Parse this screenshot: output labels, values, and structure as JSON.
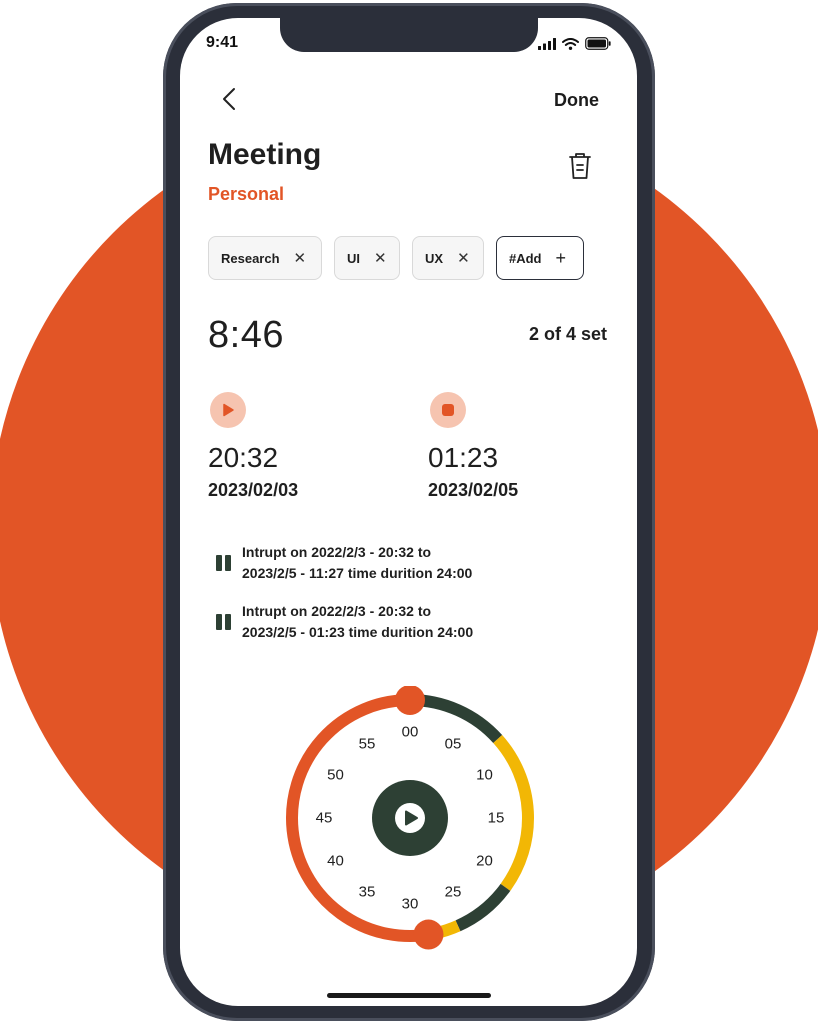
{
  "status_bar": {
    "time": "9:41"
  },
  "nav": {
    "done_label": "Done"
  },
  "task": {
    "title": "Meeting",
    "category": "Personal"
  },
  "tags": [
    {
      "label": "Research"
    },
    {
      "label": "UI"
    },
    {
      "label": "UX"
    }
  ],
  "add_tag": {
    "label": "#Add"
  },
  "timer": {
    "elapsed": "8:46",
    "set_progress": "2 of 4 set"
  },
  "sessions": {
    "start": {
      "time": "20:32",
      "date": "2023/02/03",
      "icon": "play-icon"
    },
    "end": {
      "time": "01:23",
      "date": "2023/02/05",
      "icon": "stop-icon"
    }
  },
  "interruptions": [
    {
      "line1": "Intrupt on 2022/2/3 - 20:32  to",
      "line2": "2023/2/5 - 11:27 time durition 24:00"
    },
    {
      "line1": "Intrupt on 2022/2/3 - 20:32  to",
      "line2": "2023/2/5 - 01:23 time durition 24:00"
    }
  ],
  "dial": {
    "labels": [
      "00",
      "05",
      "10",
      "15",
      "20",
      "25",
      "30",
      "35",
      "40",
      "45",
      "50",
      "55"
    ],
    "segments": [
      {
        "from_minute": 0,
        "to_minute": 8,
        "color": "#2d4034"
      },
      {
        "from_minute": 8,
        "to_minute": 21,
        "color": "#f2b705"
      },
      {
        "from_minute": 21,
        "to_minute": 26,
        "color": "#2d4034"
      },
      {
        "from_minute": 26,
        "to_minute": 28,
        "color": "#f2b705"
      },
      {
        "from_minute": 28,
        "to_minute": 60,
        "color": "#e25526"
      }
    ],
    "handles_minutes": [
      0,
      28.5
    ],
    "center_icon": "play-icon"
  },
  "colors": {
    "accent": "#e25526",
    "dark_green": "#2d4034",
    "yellow": "#f2b705",
    "light_accent": "#f6c4b0",
    "frame": "#2b2f3a"
  }
}
